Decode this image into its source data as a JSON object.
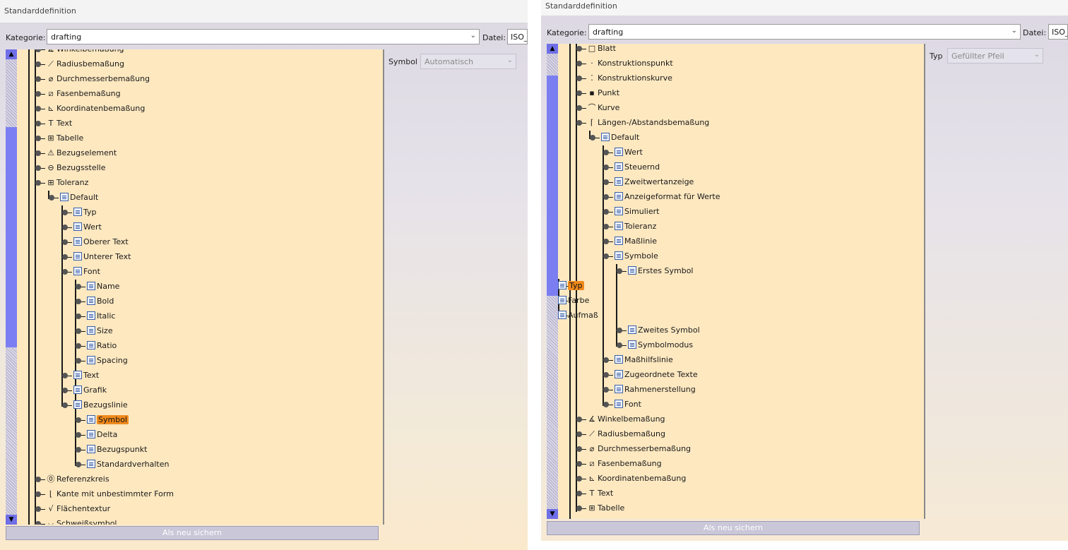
{
  "left": {
    "title": "Standarddefinition",
    "kategorie_label": "Kategorie:",
    "kategorie_value": "drafting",
    "datei_label": "Datei:",
    "datei_value": "ISO_",
    "symbol_label": "Symbol",
    "symbol_value": "Automatisch",
    "save_label": "Als neu sichern",
    "tree": [
      {
        "label": "Winkelbemaßung",
        "icon": "angle-dim-icon",
        "glyph": "∡"
      },
      {
        "label": "Radiusbemaßung",
        "icon": "radius-dim-icon",
        "glyph": "⟋"
      },
      {
        "label": "Durchmesserbemaßung",
        "icon": "diameter-dim-icon",
        "glyph": "⌀"
      },
      {
        "label": "Fasenbemaßung",
        "icon": "chamfer-dim-icon",
        "glyph": "⧄"
      },
      {
        "label": "Koordinatenbemaßung",
        "icon": "coordinate-dim-icon",
        "glyph": "⊾"
      },
      {
        "label": "Text",
        "icon": "text-icon",
        "glyph": "T"
      },
      {
        "label": "Tabelle",
        "icon": "table-icon",
        "glyph": "⊞"
      },
      {
        "label": "Bezugselement",
        "icon": "datum-element-icon",
        "glyph": "⚠"
      },
      {
        "label": "Bezugsstelle",
        "icon": "datum-target-icon",
        "glyph": "⊖"
      },
      {
        "label": "Toleranz",
        "icon": "tolerance-icon",
        "glyph": "⊞"
      },
      {
        "label": "Default",
        "icon": "param-icon"
      },
      {
        "label": "Typ",
        "icon": "param-icon"
      },
      {
        "label": "Wert",
        "icon": "param-icon"
      },
      {
        "label": "Oberer Text",
        "icon": "param-icon"
      },
      {
        "label": "Unterer Text",
        "icon": "param-icon"
      },
      {
        "label": "Font",
        "icon": "param-icon"
      },
      {
        "label": "Name",
        "icon": "param-icon"
      },
      {
        "label": "Bold",
        "icon": "param-icon"
      },
      {
        "label": "Italic",
        "icon": "param-icon"
      },
      {
        "label": "Size",
        "icon": "param-icon"
      },
      {
        "label": "Ratio",
        "icon": "param-icon"
      },
      {
        "label": "Spacing",
        "icon": "param-icon"
      },
      {
        "label": "Text",
        "icon": "param-icon"
      },
      {
        "label": "Grafik",
        "icon": "param-icon"
      },
      {
        "label": "Bezugslinie",
        "icon": "param-icon"
      },
      {
        "label": "Symbol",
        "icon": "param-icon",
        "selected": true
      },
      {
        "label": "Delta",
        "icon": "param-icon"
      },
      {
        "label": "Bezugspunkt",
        "icon": "param-icon"
      },
      {
        "label": "Standardverhalten",
        "icon": "param-icon"
      },
      {
        "label": "Referenzkreis",
        "icon": "reference-circle-icon",
        "glyph": "⓪"
      },
      {
        "label": "Kante mit unbestimmter Form",
        "icon": "undefined-edge-icon",
        "glyph": "⌊"
      },
      {
        "label": "Flächentextur",
        "icon": "surface-texture-icon",
        "glyph": "√"
      },
      {
        "label": "Schweißsymbol",
        "icon": "weld-symbol-icon",
        "glyph": "⌵"
      }
    ]
  },
  "right": {
    "title": "Standarddefinition",
    "kategorie_label": "Kategorie:",
    "kategorie_value": "drafting",
    "datei_label": "Datei:",
    "datei_value": "ISO_",
    "typ_label": "Typ",
    "typ_value": "Gefüllter Pfeil",
    "save_label": "Als neu sichern",
    "tree": [
      {
        "label": "Blatt",
        "icon": "sheet-icon",
        "glyph": "□"
      },
      {
        "label": "Konstruktionspunkt",
        "icon": "construction-point-icon",
        "glyph": "·"
      },
      {
        "label": "Konstruktionskurve",
        "icon": "construction-curve-icon",
        "glyph": "⁚"
      },
      {
        "label": "Punkt",
        "icon": "point-icon",
        "glyph": "▪"
      },
      {
        "label": "Kurve",
        "icon": "curve-icon",
        "glyph": "⌒"
      },
      {
        "label": "Längen-/Abstandsbemaßung",
        "icon": "length-dim-icon",
        "glyph": "⌈"
      },
      {
        "label": "Default",
        "icon": "param-icon"
      },
      {
        "label": "Wert",
        "icon": "param-icon"
      },
      {
        "label": "Steuernd",
        "icon": "param-icon"
      },
      {
        "label": "Zweitwertanzeige",
        "icon": "param-icon"
      },
      {
        "label": "Anzeigeformat für Werte",
        "icon": "param-icon"
      },
      {
        "label": "Simuliert",
        "icon": "param-icon"
      },
      {
        "label": "Toleranz",
        "icon": "param-icon"
      },
      {
        "label": "Maßlinie",
        "icon": "param-icon"
      },
      {
        "label": "Symbole",
        "icon": "param-icon"
      },
      {
        "label": "Erstes Symbol",
        "icon": "param-icon"
      },
      {
        "label": "Typ",
        "icon": "param-icon",
        "selected": true
      },
      {
        "label": "Farbe",
        "icon": "param-icon"
      },
      {
        "label": "Aufmaß",
        "icon": "param-icon"
      },
      {
        "label": "Zweites Symbol",
        "icon": "param-icon"
      },
      {
        "label": "Symbolmodus",
        "icon": "param-icon"
      },
      {
        "label": "Maßhilfslinie",
        "icon": "param-icon"
      },
      {
        "label": "Zugeordnete Texte",
        "icon": "param-icon"
      },
      {
        "label": "Rahmenerstellung",
        "icon": "param-icon"
      },
      {
        "label": "Font",
        "icon": "param-icon"
      },
      {
        "label": "Winkelbemaßung",
        "icon": "angle-dim-icon",
        "glyph": "∡"
      },
      {
        "label": "Radiusbemaßung",
        "icon": "radius-dim-icon",
        "glyph": "⟋"
      },
      {
        "label": "Durchmesserbemaßung",
        "icon": "diameter-dim-icon",
        "glyph": "⌀"
      },
      {
        "label": "Fasenbemaßung",
        "icon": "chamfer-dim-icon",
        "glyph": "⧄"
      },
      {
        "label": "Koordinatenbemaßung",
        "icon": "coordinate-dim-icon",
        "glyph": "⊾"
      },
      {
        "label": "Text",
        "icon": "text-icon",
        "glyph": "T"
      },
      {
        "label": "Tabelle",
        "icon": "table-icon",
        "glyph": "⊞"
      }
    ]
  },
  "colors": {
    "selection": "#f08a1c",
    "tree_bg": "#fde8c0",
    "scroll_thumb": "#7b7ef0"
  }
}
